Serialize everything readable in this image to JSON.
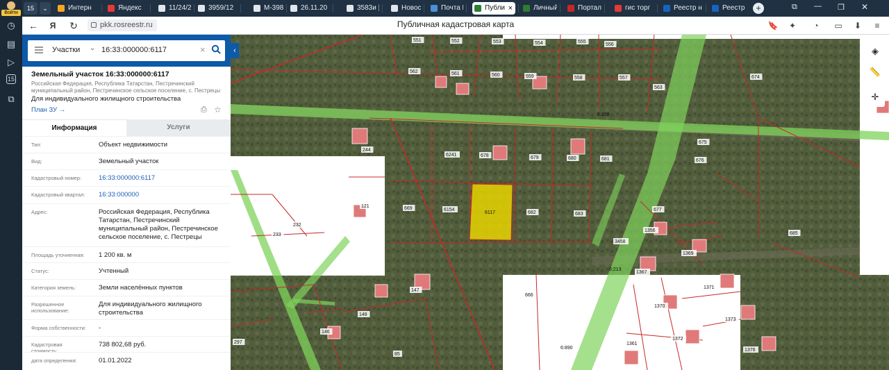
{
  "sidebar_rail": {
    "login_label": "Войти",
    "icons": [
      "clock-icon",
      "document-icon",
      "play-icon",
      "calendar-icon",
      "devices-icon"
    ],
    "badge": "15"
  },
  "tabs": [
    {
      "label": "Интерн",
      "color": "#f5a623"
    },
    {
      "label": "Яндекс",
      "color": "#e53935"
    },
    {
      "label": "11/24/2",
      "color": "#e0e6ec"
    },
    {
      "label": "3959/12",
      "color": "#e0e6ec"
    },
    {
      "label": "М-398 |",
      "color": "#e0e6ec"
    },
    {
      "label": "26.11.20",
      "color": "#e0e6ec"
    },
    {
      "label": "3583и |",
      "color": "#e0e6ec"
    },
    {
      "label": "Новость",
      "color": "#e0e6ec"
    },
    {
      "label": "Почта М",
      "color": "#4a90d9"
    },
    {
      "label": "Публи",
      "color": "#2e7d32",
      "active": true
    },
    {
      "label": "Личный",
      "color": "#2e7d32"
    },
    {
      "label": "Портал",
      "color": "#c62828"
    },
    {
      "label": "гис торг",
      "color": "#e53935"
    },
    {
      "label": "Реестр н",
      "color": "#1565c0"
    },
    {
      "label": "Реестр н",
      "color": "#1565c0"
    }
  ],
  "browser": {
    "url": "pkk.rosreestr.ru",
    "page_title": "Публичная кадастровая карта",
    "tab_counter": "15"
  },
  "search": {
    "type_label": "Участки",
    "query": "16:33:000000:6117"
  },
  "parcel": {
    "title": "Земельный участок 16:33:000000:6117",
    "address_line": "Российская Федерация, Республика Татарстан, Пестречинский муниципальный район, Пестречинское сельское поселение, с. Пестрецы",
    "purpose": "Для индивидуального жилищного строительства",
    "plan_link": "План ЗУ →"
  },
  "panel_tabs": {
    "info": "Информация",
    "services": "Услуги"
  },
  "attributes": [
    {
      "key": "Тип:",
      "value": "Объект недвижимости"
    },
    {
      "key": "Вид:",
      "value": "Земельный участок"
    },
    {
      "key": "Кадастровый номер:",
      "value": "16:33:000000:6117",
      "link": true
    },
    {
      "key": "Кадастровый квартал:",
      "value": "16:33:000000",
      "link": true
    },
    {
      "key": "Адрес:",
      "value": "Российская Федерация, Республика Татарстан, Пестречинский муниципальный район, Пестречинское сельское поселение, с. Пестрецы"
    },
    {
      "key": "Площадь уточненная:",
      "value": "1 200 кв. м"
    },
    {
      "key": "Статус:",
      "value": "Учтенный"
    },
    {
      "key": "Категория земель:",
      "value": "Земли населённых пунктов"
    },
    {
      "key": "Разрешенное использование:",
      "value": "Для индивидуального жилищного строительства"
    },
    {
      "key": "Форма собственности:",
      "value": "-"
    },
    {
      "key": "Кадастровая стоимость:",
      "value": "738 802,68 руб."
    },
    {
      "key": "дата определения:",
      "value": "01.01.2022"
    }
  ],
  "map_labels": {
    "selected": "6117",
    "parcels": [
      "551",
      "552",
      "553",
      "554",
      "555",
      "556",
      "562",
      "561",
      "560",
      "559",
      "558",
      "557",
      "563",
      "674",
      "6241",
      "678",
      "679",
      "680",
      "681",
      "675",
      "676",
      "669",
      "6154",
      "682",
      "683",
      "677",
      "1356",
      "3458",
      "1369",
      "1367",
      "121",
      "232",
      "233",
      "244",
      "666",
      "1371",
      "1370",
      "1373",
      "1372",
      "1361",
      "1376",
      "146",
      "148",
      "147",
      "297",
      "85",
      "685"
    ],
    "roads": [
      "6:358",
      "6:213",
      "6:890"
    ]
  },
  "colors": {
    "panel_header": "#0d5aa8",
    "parcel_boundary": "#c62828",
    "selected_fill": "#e6d400",
    "green_zone": "#7fd35b"
  }
}
